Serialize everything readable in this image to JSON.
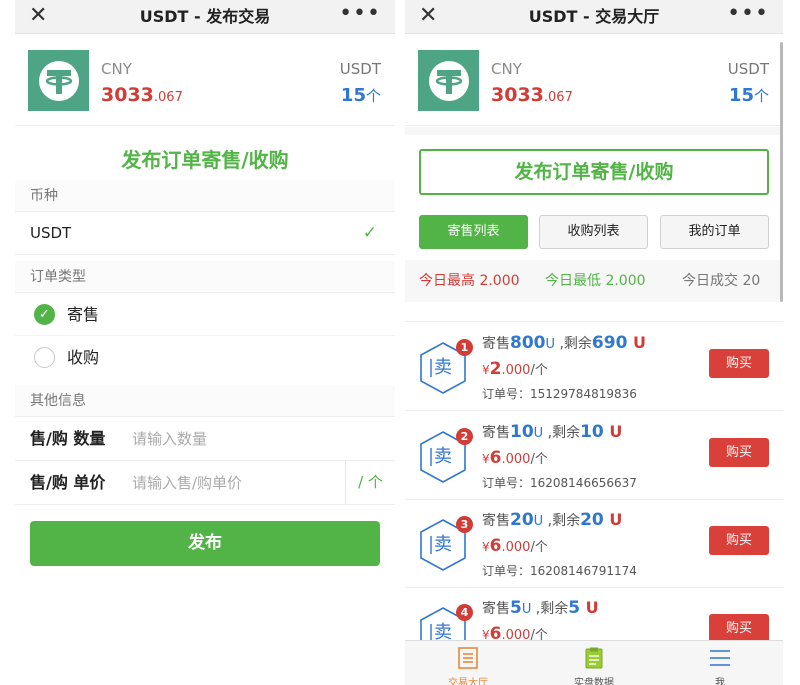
{
  "left": {
    "title": "USDT - 发布交易",
    "coin": {
      "currency": "CNY",
      "price_int": "3033",
      "price_dec": ".067",
      "unit_label": "USDT",
      "qty": "15",
      "qty_unit": "个"
    },
    "publish_title": "发布订单寄售/收购",
    "sections": {
      "coin": "币种",
      "order_type": "订单类型",
      "other": "其他信息"
    },
    "coin_value": "USDT",
    "order_types": [
      "寄售",
      "收购"
    ],
    "quantity_label": "售/购 数量",
    "quantity_placeholder": "请输入数量",
    "price_label": "售/购 单价",
    "price_placeholder": "请输入售/购单价",
    "price_unit": "/ 个",
    "submit_label": "发布"
  },
  "right": {
    "title": "USDT - 交易大厅",
    "coin": {
      "currency": "CNY",
      "price_int": "3033",
      "price_dec": ".067",
      "unit_label": "USDT",
      "qty": "15",
      "qty_unit": "个"
    },
    "publish_button": "发布订单寄售/收购",
    "tabs": [
      "寄售列表",
      "收购列表",
      "我的订单"
    ],
    "stats": {
      "high": "今日最高 2.000",
      "low": "今日最低 2.000",
      "volume": "今日成交 20"
    },
    "orders": [
      {
        "rank": "1",
        "icon_char": "卖",
        "sell_prefix": "寄售",
        "amount": "800",
        "unit": "U",
        "remain_prefix": " ,剩余",
        "remain": "690",
        "remain_unit": " U",
        "yen": "¥",
        "price_int": "2",
        "price_dec": ".000",
        "per": "/个",
        "order_no": "订单号：15129784819836",
        "buy_label": "购买"
      },
      {
        "rank": "2",
        "icon_char": "卖",
        "sell_prefix": "寄售",
        "amount": "10",
        "unit": "U",
        "remain_prefix": " ,剩余",
        "remain": "10",
        "remain_unit": " U",
        "yen": "¥",
        "price_int": "6",
        "price_dec": ".000",
        "per": "/个",
        "order_no": "订单号：16208146656637",
        "buy_label": "购买"
      },
      {
        "rank": "3",
        "icon_char": "卖",
        "sell_prefix": "寄售",
        "amount": "20",
        "unit": "U",
        "remain_prefix": " ,剩余",
        "remain": "20",
        "remain_unit": " U",
        "yen": "¥",
        "price_int": "6",
        "price_dec": ".000",
        "per": "/个",
        "order_no": "订单号：16208146791174",
        "buy_label": "购买"
      },
      {
        "rank": "4",
        "icon_char": "卖",
        "sell_prefix": "寄售",
        "amount": "5",
        "unit": "U",
        "remain_prefix": " ,剩余",
        "remain": "5",
        "remain_unit": " U",
        "yen": "¥",
        "price_int": "6",
        "price_dec": ".000",
        "per": "/个",
        "order_no": "",
        "buy_label": "购买"
      }
    ],
    "tabbar": [
      {
        "label": "交易大厅",
        "icon": "list-doc-icon"
      },
      {
        "label": "实盘数据",
        "icon": "clipboard-icon"
      },
      {
        "label": "我",
        "icon": "menu-icon"
      }
    ]
  },
  "colors": {
    "green": "#52b446",
    "red": "#d23c37",
    "blue": "#2f77cf",
    "tether": "#4ea586",
    "orange": "#e8883a"
  },
  "icons": {
    "close": "close-icon",
    "more": "more-icon",
    "check": "check-icon",
    "logo": "tether-logo-icon",
    "hex": "hexagon-sell-icon"
  }
}
